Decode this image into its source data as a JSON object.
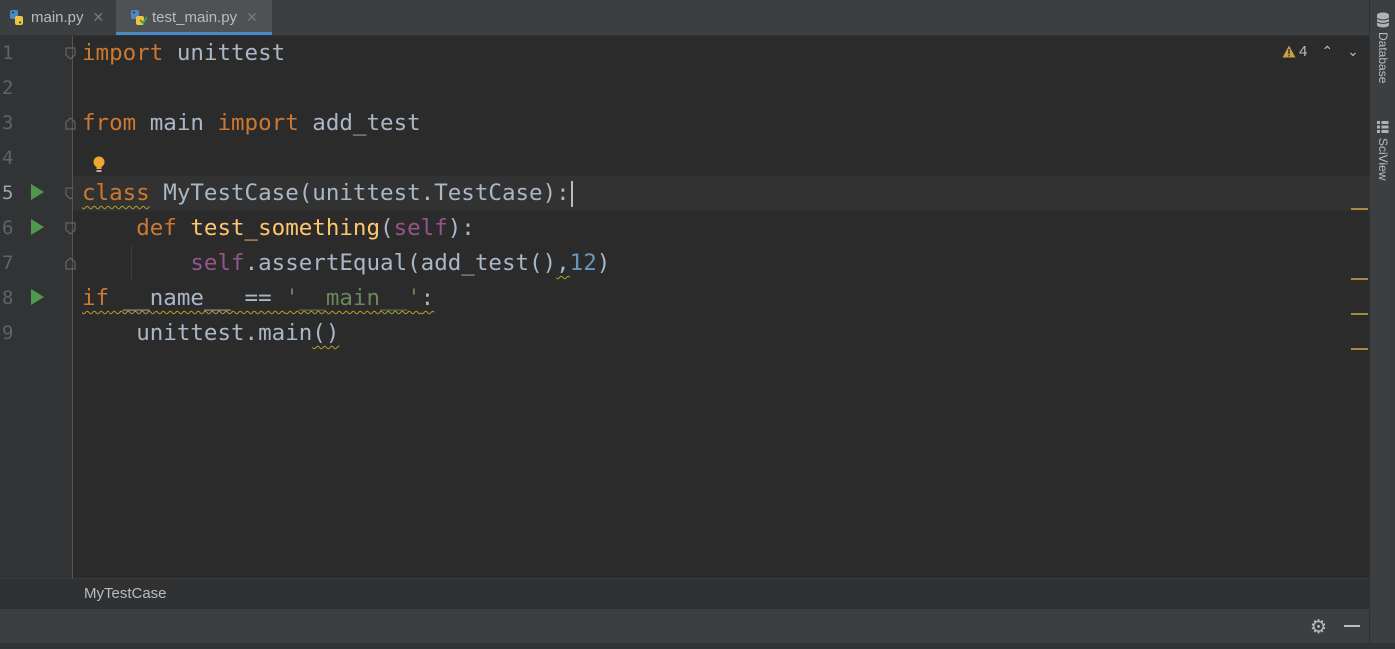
{
  "tabs": [
    {
      "label": "main.py",
      "close": "✕",
      "active": false
    },
    {
      "label": "test_main.py",
      "close": "✕",
      "active": true
    }
  ],
  "tool_windows": [
    {
      "label": "Database",
      "icon": "database-icon"
    },
    {
      "label": "SciView",
      "icon": "sciview-icon"
    }
  ],
  "inspections": {
    "warning_count": "4",
    "up": "⌃",
    "down": "⌄"
  },
  "line_numbers": [
    "1",
    "2",
    "3",
    "4",
    "5",
    "6",
    "7",
    "8",
    "9"
  ],
  "code": {
    "l1": {
      "kw": "import",
      "rest": " unittest"
    },
    "l3": {
      "kw1": "from",
      "mid": " main ",
      "kw2": "import",
      "rest": " add_test"
    },
    "l5": {
      "kw": "class",
      "name": "MyTestCase",
      "rest": "(unittest.TestCase):"
    },
    "l6": {
      "indent": "    ",
      "kw": "def",
      "fn": "test_something",
      "open": "(",
      "self": "self",
      "close": "):"
    },
    "l7": {
      "indent": "        ",
      "self": "self",
      "call": ".assertEqual(add_test()",
      "comma": ",",
      "num": "12",
      "close": ")"
    },
    "l8": {
      "kw": "if",
      "mid": " __name__ == ",
      "str": "'__main__'",
      "colon": ":"
    },
    "l9": {
      "indent": "    ",
      "call": "unittest.main",
      "parens": "()"
    }
  },
  "breadcrumb": "MyTestCase",
  "colors": {
    "keyword": "#cc7832",
    "function": "#ffc66d",
    "self": "#94558d",
    "number": "#6897bb",
    "string": "#6a8759",
    "text": "#a9b7c6",
    "background": "#2b2b2b"
  }
}
